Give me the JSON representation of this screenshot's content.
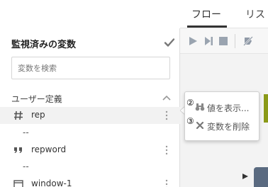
{
  "tabs": [
    {
      "label": "フロー"
    },
    {
      "label": "リス"
    }
  ],
  "panel": {
    "title": "監視済みの変数",
    "search_placeholder": "変数を検索",
    "section_label": "ユーザー定義"
  },
  "variables": [
    {
      "icon": "hash-icon",
      "name": "rep",
      "value": "--"
    },
    {
      "icon": "quote-icon",
      "name": "repword",
      "value": "--"
    },
    {
      "icon": "window-icon",
      "name": "window-1",
      "value": ""
    }
  ],
  "context_menu": {
    "items": [
      {
        "step": "②",
        "icon": "binoculars-icon",
        "label": "値を表示..."
      },
      {
        "step": "③",
        "icon": "close-icon",
        "label": "変数を削除"
      }
    ]
  },
  "colors": {
    "node": "#5a6a80",
    "accent_strip": "#8a9a18"
  }
}
